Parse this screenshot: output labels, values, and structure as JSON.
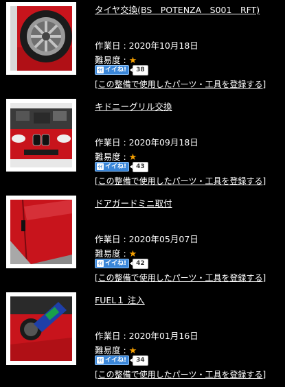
{
  "items": [
    {
      "title": "タイヤ交換(BS　POTENZA　S001　RFT)",
      "date": "作業日 : 2020年10月18日",
      "difficulty_label": "難易度 :",
      "difficulty_star": "★",
      "like_icon": "ｲｲ",
      "like_label": "イイね!",
      "like_count": "38",
      "register_link": "[この整備で使用したパーツ・工具を登録する]"
    },
    {
      "title": "キドニーグリル交換",
      "date": "作業日 : 2020年09月18日",
      "difficulty_label": "難易度 :",
      "difficulty_star": "★",
      "like_icon": "ｲｲ",
      "like_label": "イイね!",
      "like_count": "43",
      "register_link": "[この整備で使用したパーツ・工具を登録する]"
    },
    {
      "title": "ドアガードミニ取付",
      "date": "作業日 : 2020年05月07日",
      "difficulty_label": "難易度 :",
      "difficulty_star": "★",
      "like_icon": "ｲｲ",
      "like_label": "イイね!",
      "like_count": "42",
      "register_link": "[この整備で使用したパーツ・工具を登録する]"
    },
    {
      "title": "FUEL１ 注入",
      "date": "作業日 : 2020年01月16日",
      "difficulty_label": "難易度 :",
      "difficulty_star": "★",
      "like_icon": "ｲｲ",
      "like_label": "イイね!",
      "like_count": "34",
      "register_link": "[この整備で使用したパーツ・工具を登録する]"
    }
  ],
  "colors": {
    "background": "#000000",
    "text": "#ffffff",
    "star": "#f6a000",
    "like_button": "#3a86d8",
    "car_red": "#c8141c"
  },
  "icons": [
    "tire-photo",
    "kidney-grill-photo",
    "door-guard-photo",
    "fuel-additive-photo",
    "like-icon"
  ]
}
